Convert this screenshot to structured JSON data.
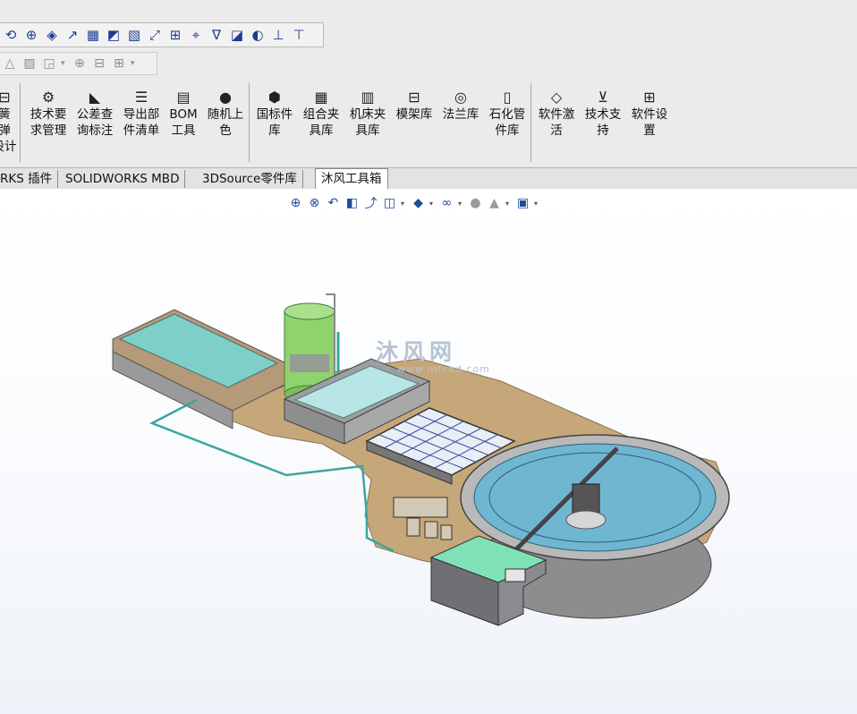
{
  "toolbar": {
    "row1_icons": [
      "view-orient-icon",
      "view-rotate-icon",
      "view-section-icon",
      "view-zoom-icon",
      "sketch-icon",
      "sketch-check-icon",
      "smart-dimension-icon",
      "reference-icon",
      "reference-geometry-icon",
      "mate-icon",
      "note-icon",
      "display-style-icon",
      "measure-icon",
      "weld-icon"
    ],
    "row2_icons": [
      "appearance-icon",
      "texture-icon",
      "decal-icon",
      "target-icon",
      "section-view-icon",
      "grid-icon"
    ],
    "buttons": [
      {
        "icon": "spring-icon",
        "label": "簧\n弹\n设计"
      },
      {
        "icon": "tech-requirement-icon",
        "label": "技术要\n求管理"
      },
      {
        "icon": "tolerance-icon",
        "label": "公差查\n询标注"
      },
      {
        "icon": "export-list-icon",
        "label": "导出部\n件清单"
      },
      {
        "icon": "bom-icon",
        "label": "BOM\n工具"
      },
      {
        "icon": "palette-icon",
        "label": "随机上\n色"
      },
      {
        "icon": "nut-icon",
        "label": "国标件\n库"
      },
      {
        "icon": "fixture-icon",
        "label": "组合夹\n具库"
      },
      {
        "icon": "machine-fixture-icon",
        "label": "机床夹\n具库"
      },
      {
        "icon": "mold-frame-icon",
        "label": "模架库"
      },
      {
        "icon": "flange-icon",
        "label": "法兰库"
      },
      {
        "icon": "petrochem-pipe-icon",
        "label": "石化管\n件库"
      },
      {
        "icon": "diamond-icon",
        "label": "软件激\n活"
      },
      {
        "icon": "support-icon",
        "label": "技术支\n持"
      },
      {
        "icon": "settings-icon",
        "label": "软件设\n置"
      }
    ]
  },
  "tabs": [
    {
      "label": "RKS 插件",
      "active": false
    },
    {
      "label": "SOLIDWORKS MBD",
      "active": false
    },
    {
      "label": "3DSource零件库",
      "active": false
    },
    {
      "label": "沐风工具箱",
      "active": true
    }
  ],
  "heads_up_toolbar": [
    "zoom-to-fit-icon",
    "zoom-area-icon",
    "previous-view-icon",
    "section-view-icon",
    "dynamic-annotation-icon",
    "view-orientation-icon",
    "display-style-icon",
    "hide-show-icon",
    "edit-appearance-icon",
    "apply-scene-icon",
    "view-settings-icon"
  ],
  "watermark": {
    "logo": "沐风网",
    "url": "www.mfcad.com"
  },
  "colors": {
    "toolbar_bg": "#ebebeb",
    "ground": "#c6a77a",
    "water": "#7fcfc9",
    "tank_wall": "#9a9a9a",
    "pipe": "#3aa6a0"
  }
}
